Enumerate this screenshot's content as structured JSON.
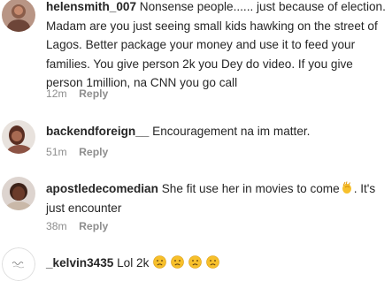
{
  "comments": [
    {
      "username": "helensmith_007",
      "text": "Nonsense people...... just because of election. Madam are you just seeing small kids hawking on the street of Lagos. Better package your money and use it to feed your families. You give person 2k you Dey do video. If you give person 1million, na CNN you go call",
      "time": "12m",
      "reply": "Reply"
    },
    {
      "username": "backendforeign__",
      "text": "Encouragement na im matter.",
      "time": "51m",
      "reply": "Reply"
    },
    {
      "username": "apostledecomedian",
      "text": "She fit use her in movies to come",
      "text_after": ". It's just encounter",
      "emoji": "clapping-hands-icon",
      "time": "38m",
      "reply": "Reply"
    },
    {
      "username": "_kelvin3435",
      "text": "Lol 2k",
      "emoji": "sad-face-icon",
      "emoji_count": 4
    }
  ],
  "colors": {
    "text": "#262626",
    "muted": "#8e8e8e",
    "emoji_yellow": "#f7c02b"
  }
}
